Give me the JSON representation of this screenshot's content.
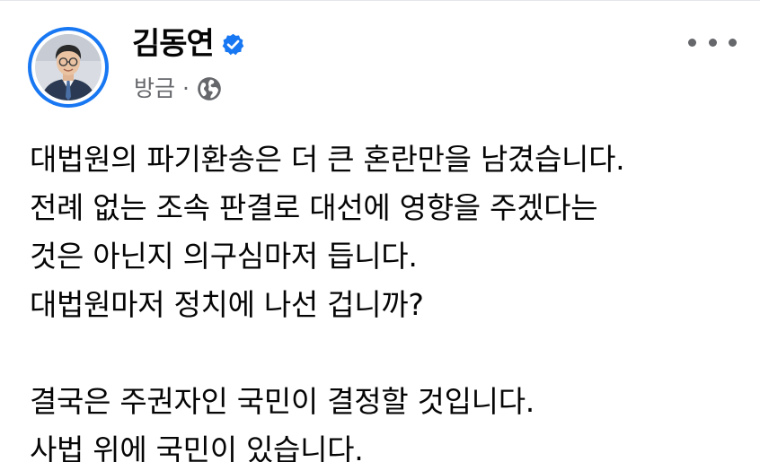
{
  "post": {
    "author": "김동연",
    "verified": true,
    "time": "방금",
    "separator": "·",
    "audience_icon": "globe-icon",
    "more_icon": "more-dots-icon",
    "colors": {
      "accent": "#1877f2",
      "secondary_text": "#65676b",
      "primary_text": "#050505"
    },
    "paragraphs": [
      [
        "대법원의 파기환송은 더 큰 혼란만을 남겼습니다.",
        "전례 없는 조속 판결로 대선에 영향을 주겠다는",
        "것은 아닌지 의구심마저 듭니다.",
        "대법원마저 정치에 나선 겁니까?"
      ],
      [
        "결국은 주권자인 국민이 결정할 것입니다.",
        "사법 위에 국민이 있습니다."
      ]
    ]
  }
}
